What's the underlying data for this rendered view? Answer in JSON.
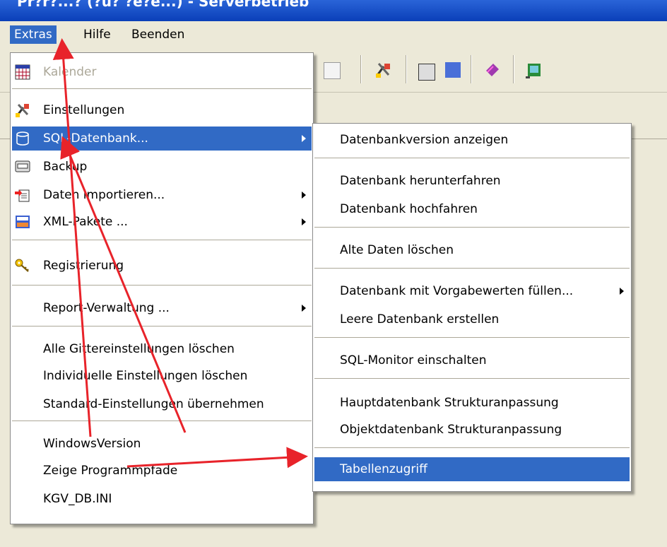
{
  "window": {
    "title": "Pr?r?...? (?u? ?e?e...) - Serverbetrieb"
  },
  "menubar": {
    "items": [
      "Extras",
      "Hilfe",
      "Beenden"
    ]
  },
  "extras_menu": {
    "items": [
      {
        "label": "Kalender",
        "icon": "calendar-icon",
        "disabled": true
      },
      {
        "label": "Einstellungen",
        "icon": "tools-icon"
      },
      {
        "label": "SQL-Datenbank...",
        "icon": "database-icon",
        "highlighted": true,
        "submenu": true
      },
      {
        "label": "Backup",
        "icon": "backup-icon"
      },
      {
        "label": "Daten importieren...",
        "icon": "import-icon",
        "submenu": true
      },
      {
        "label": "XML-Pakete ...",
        "icon": "xml-icon",
        "submenu": true
      },
      {
        "label": "Registrierung",
        "icon": "key-icon"
      },
      {
        "label": "Report-Verwaltung ...",
        "submenu": true
      },
      {
        "label": "Alle Gittereinstellungen löschen"
      },
      {
        "label": "Individuelle Einstellungen löschen"
      },
      {
        "label": "Standard-Einstellungen übernehmen"
      },
      {
        "label": "WindowsVersion"
      },
      {
        "label": "Zeige Programmpfade"
      },
      {
        "label": "KGV_DB.INI"
      }
    ]
  },
  "sql_submenu": {
    "items": [
      {
        "label": "Datenbankversion anzeigen"
      },
      {
        "label": "Datenbank herunterfahren"
      },
      {
        "label": "Datenbank hochfahren"
      },
      {
        "label": "Alte Daten löschen"
      },
      {
        "label": "Datenbank mit Vorgabewerten füllen...",
        "submenu": true
      },
      {
        "label": "Leere Datenbank erstellen"
      },
      {
        "label": "SQL-Monitor einschalten"
      },
      {
        "label": "Hauptdatenbank Strukturanpassung"
      },
      {
        "label": "Objektdatenbank Strukturanpassung"
      },
      {
        "label": "Tabellenzugriff",
        "highlighted": true
      }
    ]
  },
  "colors": {
    "highlight": "#316ac5",
    "annotation_arrow": "#e8232a",
    "menu_bg": "#ffffff",
    "window_bg": "#ece9d8"
  }
}
